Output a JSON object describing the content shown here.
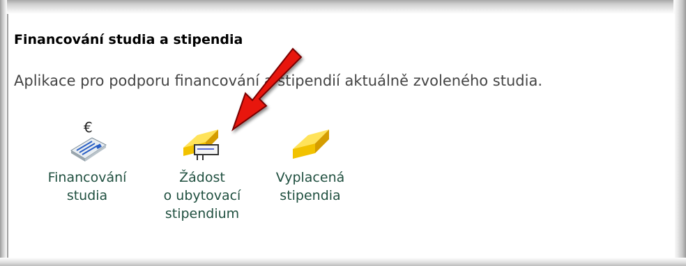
{
  "section": {
    "title": "Financování studia a stipendia",
    "description": "Aplikace pro podporu financování a stipendií aktuálně zvoleného studia."
  },
  "apps": [
    {
      "label": "Financování\nstudia",
      "icon": "euro-document-icon"
    },
    {
      "label": "Žádost\no ubytovací\nstipendium",
      "icon": "gold-bar-form-icon"
    },
    {
      "label": "Vyplacená\nstipendia",
      "icon": "gold-bar-icon"
    }
  ],
  "annotation": {
    "icon": "red-arrow-icon",
    "color": "#e8150f"
  },
  "colors": {
    "link_text": "#1f4f3f",
    "gold": "#f2c200"
  }
}
